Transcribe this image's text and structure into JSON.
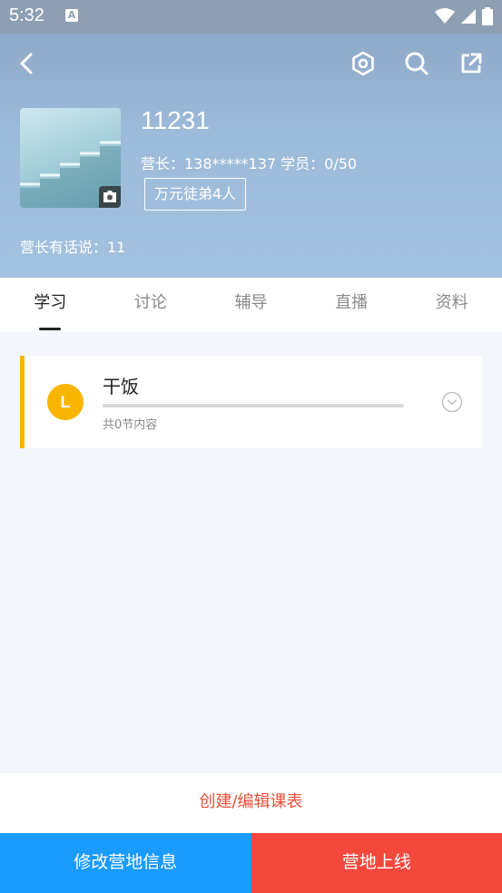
{
  "status_bar": {
    "time": "5:32",
    "notification_badge": "A"
  },
  "header": {
    "icons": [
      "back-icon",
      "settings-hexagon-icon",
      "search-icon",
      "share-icon"
    ],
    "camp_title": "11231",
    "camp_meta": "营长：138*****137 学员：0/50",
    "camp_tag": "万元徒弟4人",
    "camp_says": "营长有话说：11"
  },
  "tabs": [
    {
      "label": "学习",
      "active": true
    },
    {
      "label": "讨论",
      "active": false
    },
    {
      "label": "辅导",
      "active": false
    },
    {
      "label": "直播",
      "active": false
    },
    {
      "label": "资料",
      "active": false
    }
  ],
  "lesson_card": {
    "badge": "L",
    "title": "干饭",
    "progress": 0,
    "subtitle": "共0节内容",
    "accent_color": "#f7b500"
  },
  "actions": {
    "create_edit_schedule": "创建/编辑课表",
    "edit_camp_info": "修改营地信息",
    "camp_go_live": "营地上线"
  },
  "colors": {
    "primary_blue": "#1a9bff",
    "primary_red": "#f5483c",
    "link_red": "#e8503a"
  }
}
